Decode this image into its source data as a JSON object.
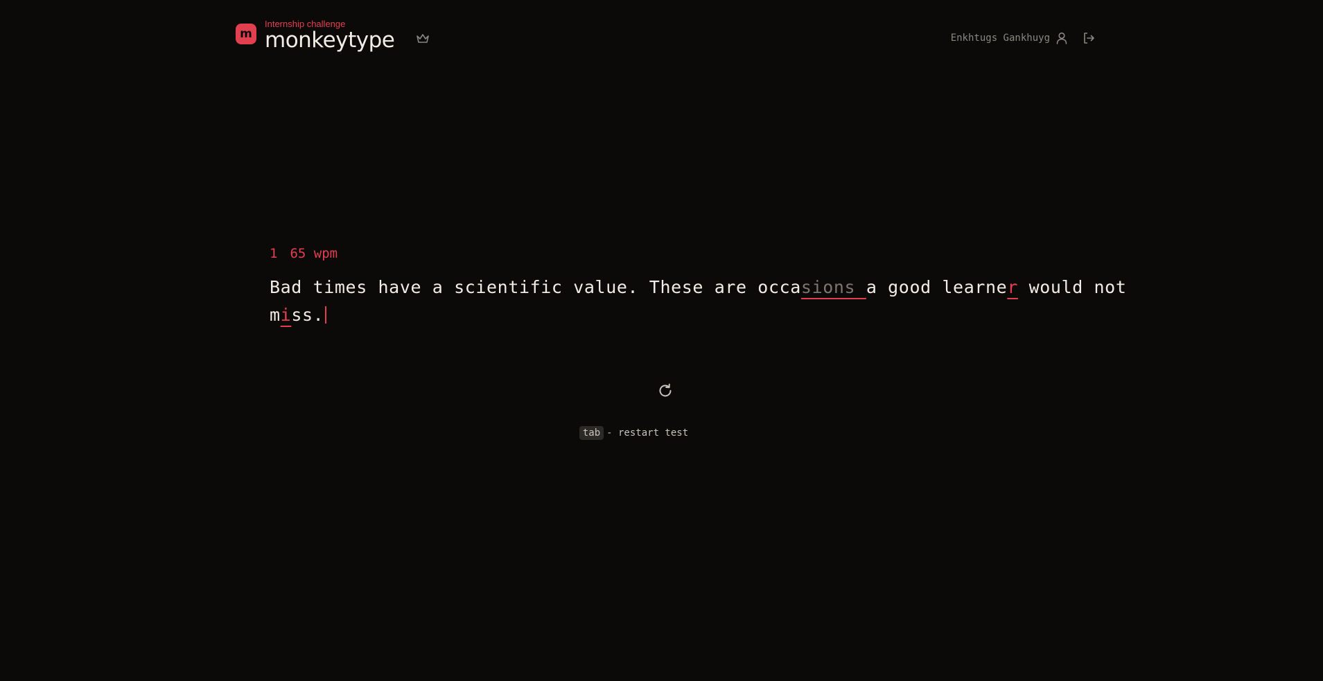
{
  "header": {
    "subtitle": "Internship challenge",
    "title": "monkeytype",
    "logo_letter": "m",
    "user_name": "Enkhtugs Gankhuyg",
    "icons": [
      "crown-icon",
      "user-icon",
      "logout-icon"
    ]
  },
  "test": {
    "word_count": "1",
    "wpm": "65 wpm",
    "line1": {
      "seg_a": "Bad times have a scientific value. These are occa",
      "seg_missed": "sions ",
      "seg_b": "a good learne",
      "seg_err": "r",
      "seg_c": " would not"
    },
    "line2": {
      "seg_a": "m",
      "seg_err": "i",
      "seg_b": "ss."
    }
  },
  "footer": {
    "key": "tab",
    "hint": "- restart test",
    "restart_icon": "refresh-icon"
  },
  "colors": {
    "background": "#0b0a09",
    "accent": "#e2404f",
    "text": "#f1ede4",
    "muted": "#7b776f"
  }
}
